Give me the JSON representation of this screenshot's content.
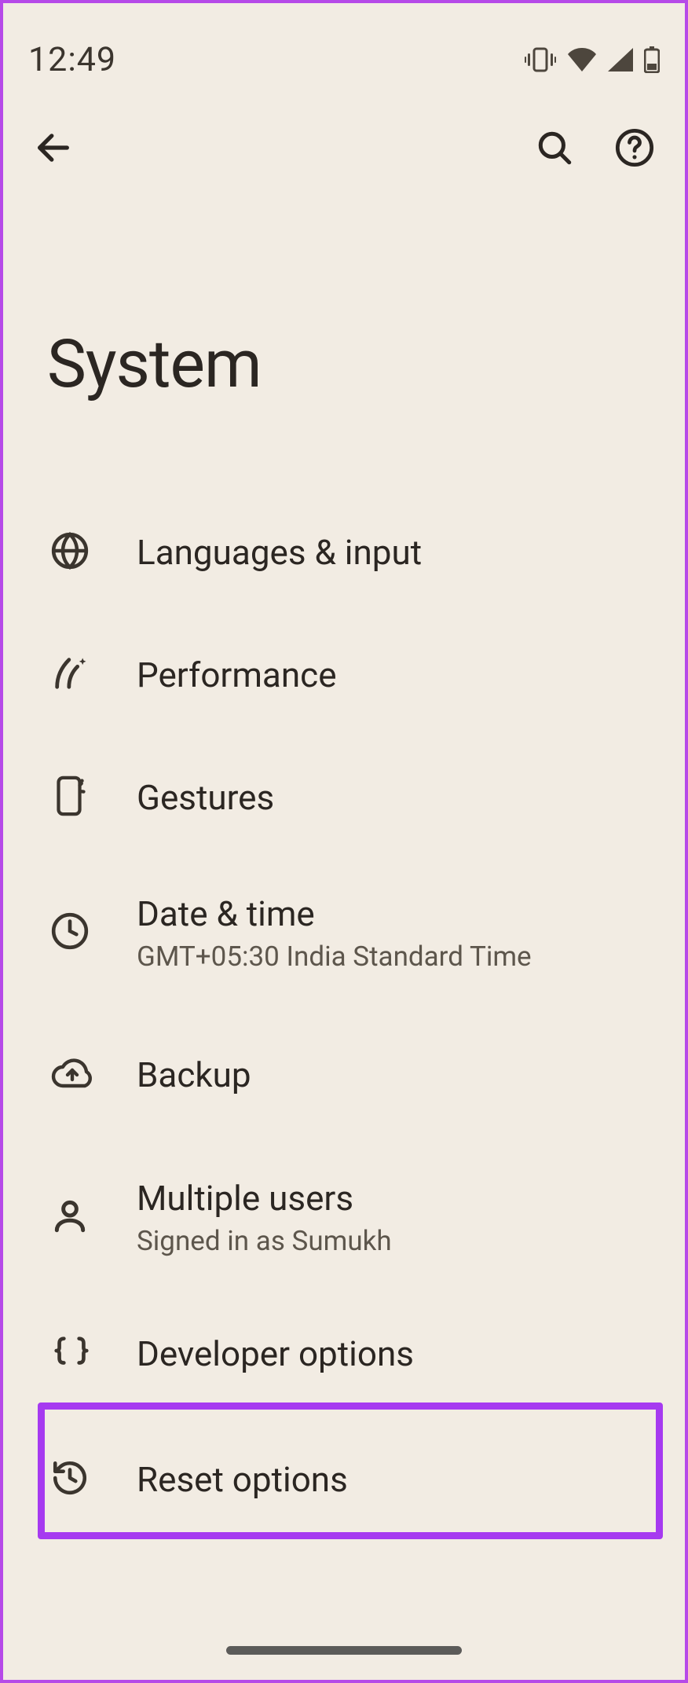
{
  "statusbar": {
    "time": "12:49"
  },
  "header": {
    "title": "System"
  },
  "items": [
    {
      "icon": "globe",
      "title": "Languages & input",
      "sub": ""
    },
    {
      "icon": "perf",
      "title": "Performance",
      "sub": ""
    },
    {
      "icon": "gesture",
      "title": "Gestures",
      "sub": ""
    },
    {
      "icon": "clock",
      "title": "Date & time",
      "sub": "GMT+05:30 India Standard Time"
    },
    {
      "icon": "backup",
      "title": "Backup",
      "sub": ""
    },
    {
      "icon": "user",
      "title": "Multiple users",
      "sub": "Signed in as Sumukh"
    },
    {
      "icon": "braces",
      "title": "Developer options",
      "sub": ""
    },
    {
      "icon": "history",
      "title": "Reset options",
      "sub": ""
    }
  ],
  "highlight_index": 7
}
